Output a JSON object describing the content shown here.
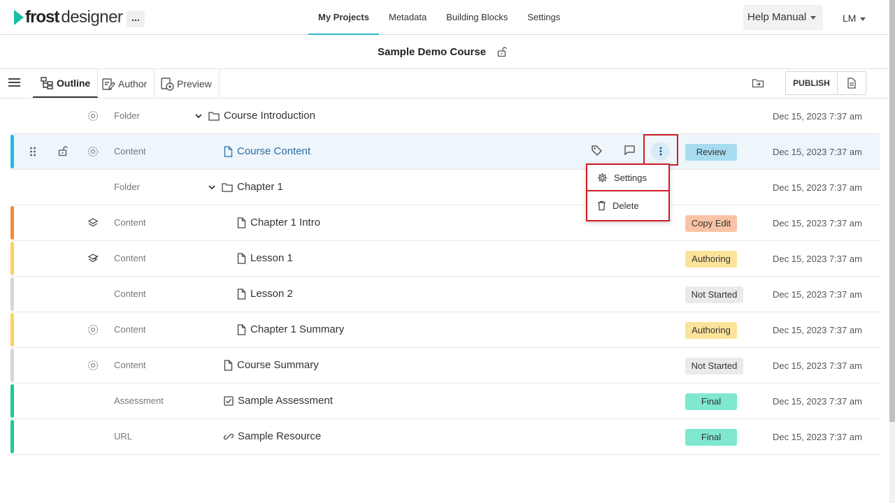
{
  "header": {
    "brand_bold": "frost",
    "brand_light": "designer",
    "more": "...",
    "nav": [
      {
        "label": "My Projects",
        "active": true
      },
      {
        "label": "Metadata"
      },
      {
        "label": "Building Blocks"
      },
      {
        "label": "Settings"
      }
    ],
    "help_label": "Help Manual",
    "user_initials": "LM"
  },
  "course": {
    "title": "Sample Demo Course"
  },
  "toolbar": {
    "tabs": [
      {
        "label": "Outline",
        "active": true
      },
      {
        "label": "Author"
      },
      {
        "label": "Preview"
      }
    ],
    "publish_label": "PUBLISH"
  },
  "rows": [
    {
      "type": "Folder",
      "name": "Course Introduction",
      "date": "Dec 15, 2023 7:37 am"
    },
    {
      "type": "Content",
      "name": "Course Content",
      "status": "Review",
      "date": "Dec 15, 2023 7:37 am"
    },
    {
      "type": "Folder",
      "name": "Chapter 1",
      "date": "Dec 15, 2023 7:37 am"
    },
    {
      "type": "Content",
      "name": "Chapter 1 Intro",
      "status": "Copy Edit",
      "date": "Dec 15, 2023 7:37 am"
    },
    {
      "type": "Content",
      "name": "Lesson 1",
      "status": "Authoring",
      "date": "Dec 15, 2023 7:37 am"
    },
    {
      "type": "Content",
      "name": "Lesson 2",
      "status": "Not Started",
      "date": "Dec 15, 2023 7:37 am"
    },
    {
      "type": "Content",
      "name": "Chapter 1 Summary",
      "status": "Authoring",
      "date": "Dec 15, 2023 7:37 am"
    },
    {
      "type": "Content",
      "name": "Course Summary",
      "status": "Not Started",
      "date": "Dec 15, 2023 7:37 am"
    },
    {
      "type": "Assessment",
      "name": "Sample Assessment",
      "status": "Final",
      "date": "Dec 15, 2023 7:37 am"
    },
    {
      "type": "URL",
      "name": "Sample Resource",
      "status": "Final",
      "date": "Dec 15, 2023 7:37 am"
    }
  ],
  "context_menu": {
    "settings": "Settings",
    "delete": "Delete"
  },
  "colors": {
    "accent": "#1bbfa3",
    "nav_underline": "#2fb6c9",
    "highlight_box": "#d01c24",
    "review": "#a8dcf0",
    "copy_edit": "#f9c4a5",
    "authoring": "#fbe39a",
    "not_started": "#eaeaea",
    "final": "#7fe8cf"
  }
}
